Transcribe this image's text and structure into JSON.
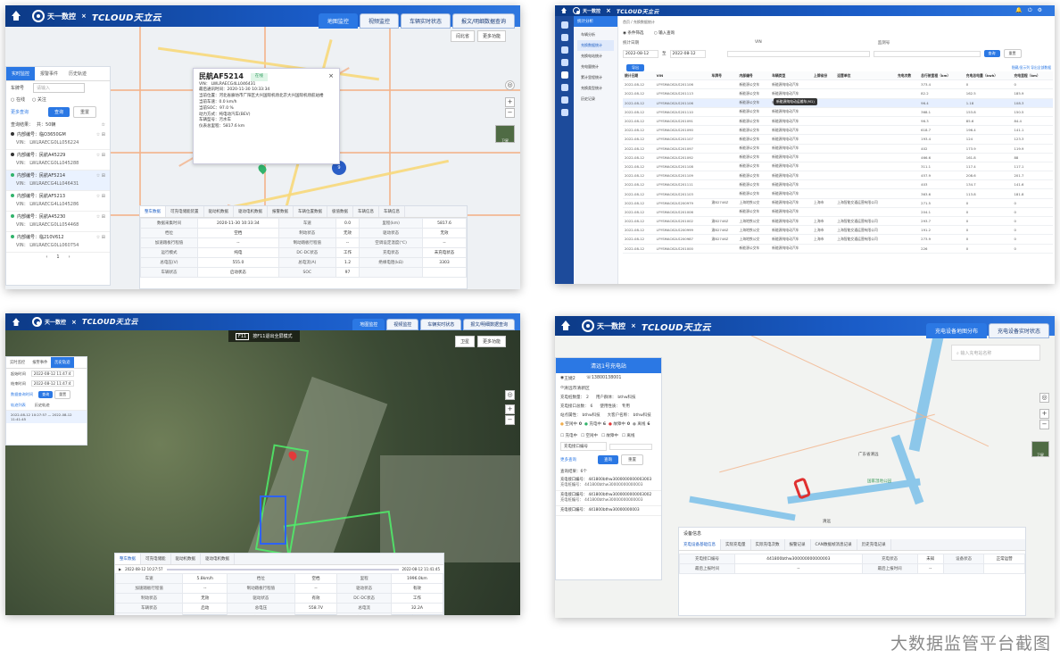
{
  "brand": {
    "logo1": "天一数控",
    "logo2": "TCLOUD天立云",
    "separator": "×"
  },
  "p1": {
    "tabs": [
      "地图监控",
      "视频监控",
      "车辆实时状态",
      "报文/明细数据查询"
    ],
    "active_tab": 0,
    "map_controls": [
      "闫北省",
      "更多功能"
    ],
    "side_tabs": [
      "实时监控",
      "报警事件",
      "历史轨迹"
    ],
    "plate_label": "车牌号",
    "plate_placeholder": "请输入",
    "opts": [
      "在线",
      "关注"
    ],
    "more_query": "更多查询",
    "btn_query": "查询",
    "btn_reset": "重置",
    "result_label": "查询结果：",
    "result_count": "共：50辆",
    "vehicles": [
      {
        "id": "内部编号：临O3650GM",
        "vin": "VIN： LWLRAECG0LL056224",
        "green": false,
        "sel": false
      },
      {
        "id": "内部编号：民航A45229",
        "vin": "VIN： LWLRAECG0LL045288",
        "green": false,
        "sel": false
      },
      {
        "id": "内部编号：民航AF5214",
        "vin": "VIN： LWLRAECG4LL046431",
        "green": true,
        "sel": true
      },
      {
        "id": "内部编号：民航AF5213",
        "vin": "VIN： LWLRAECG4LL045286",
        "green": true,
        "sel": false
      },
      {
        "id": "内部编号：民航A45230",
        "vin": "VIN： LWLRAECG0LL054468",
        "green": true,
        "sel": false
      },
      {
        "id": "内部编号：临210V612",
        "vin": "VIN： LWLRAECG0LL060754",
        "green": true,
        "sel": false
      }
    ],
    "page": "1",
    "popup": {
      "title": "民航AF5214",
      "status": "在线",
      "lines": [
        "VIN： LWLRAECG4LL046431",
        "最后通讯时间：2020-11-30 10:33:34",
        "当前位置：河北省廊坊市广阳区大兴国际机场北京大兴国际机场航站楼",
        "当前车速：0.0 km/h",
        "当前SOC：97.0 %",
        "动力方式：纯电动汽车(BEV)",
        "车辆型号：污水车",
        "仪表总里程：5817.6 km"
      ]
    },
    "cluster_count": "9",
    "detail_tabs": [
      "整车数据",
      "可充电储能装置",
      "驱动机数据",
      "驱动电机数据",
      "报警数据",
      "车辆位置数据",
      "极值数据",
      "车辆信息",
      "车辆信息"
    ],
    "detail_rows": [
      [
        "数据采集时间",
        "2020-11-30 10:33:34",
        "车速",
        "0.0",
        "里程(km)",
        "5817.6"
      ],
      [
        "档位",
        "空档",
        "制动状态",
        "无效",
        "驱动状态",
        "无效"
      ],
      [
        "加速踏板行程值",
        "--",
        "制动踏板行程值",
        "--",
        "空调设定温度(℃)",
        "--"
      ],
      [
        "运行模式",
        "纯电",
        "DC-DC状态",
        "工作",
        "充电状态",
        "未充电状态"
      ],
      [
        "总电压(V)",
        "555.0",
        "总电流(A)",
        "1.2",
        "绝缘电阻(kΩ)",
        "3303"
      ],
      [
        "车辆状态",
        "启动状态",
        "SOC",
        "97",
        "",
        ""
      ]
    ],
    "zoom_label": "卫星"
  },
  "p2": {
    "title": "统计分析",
    "breadcrumb": "首页 / 充换数据统计",
    "nav": [
      "车辆分析",
      "充换数据统计",
      "充换电站统计",
      "充电量统计",
      "累计里程统计",
      "充换类型统计",
      "历史记录"
    ],
    "filter_tabs": [
      "条件筛选",
      "输入查询"
    ],
    "filter_labels": [
      "统计日期",
      "VIN",
      "监测号"
    ],
    "filter_date": "2022-08-12",
    "filter_sep": "至",
    "btn_query": "查询",
    "btn_reset": "重置",
    "btn_export": "导出",
    "right_links": [
      "隐藏/显示列",
      "导出全部数据"
    ],
    "tooltip": "新能源纯电动运输车(M1)",
    "columns": [
      "统计日期",
      "VIN",
      "车牌号",
      "内部编号",
      "车辆类型",
      "上牌省份",
      "运营单位",
      "充电次数",
      "总行驶里程（km）",
      "充电总电量（kwh）",
      "充电里程（km）"
    ],
    "rows": [
      [
        "2022-08-12",
        "LFYSMAC62LS201106",
        "",
        "新能源公交车",
        "新能源纯电动汽车",
        "",
        "",
        "",
        "373.4",
        "0",
        "0"
      ],
      [
        "2022-08-12",
        "LFYSMAC62LS201113",
        "",
        "新能源公交车",
        "新能源纯电动汽车",
        "",
        "",
        "",
        "82.2",
        "162.5",
        "185.9"
      ],
      [
        "2022-08-12",
        "LFYSMAC62LS201106",
        "",
        "新能源公交车",
        "新能源纯电动汽车",
        "",
        "",
        "",
        "96.4",
        "1.18",
        "108.3"
      ],
      [
        "2022-08-12",
        "LFYSMAC62LS201110",
        "",
        "新能源公交车",
        "新能源纯电动汽车",
        "",
        "",
        "",
        "368.1",
        "153.8",
        "150.5"
      ],
      [
        "2022-08-12",
        "LFYSMAC62LS201091",
        "",
        "新能源公交车",
        "新能源纯电动汽车",
        "",
        "",
        "",
        "96.3",
        "85.6",
        "84.4"
      ],
      [
        "2022-08-12",
        "LFYSMAC62LS201090",
        "",
        "新能源公交车",
        "新能源纯电动汽车",
        "",
        "",
        "",
        "618.7",
        "196.4",
        "141.1"
      ],
      [
        "2022-08-12",
        "LFYSMAC62LS201107",
        "",
        "新能源公交车",
        "新能源纯电动汽车",
        "",
        "",
        "",
        "193.4",
        "124",
        "123.3"
      ],
      [
        "2022-08-12",
        "LFYSMAC62LS201097",
        "",
        "新能源公交车",
        "新能源纯电动汽车",
        "",
        "",
        "",
        "402",
        "173.9",
        "119.9"
      ],
      [
        "2022-08-12",
        "LFYSMAC62LS201092",
        "",
        "新能源公交车",
        "新能源纯电动汽车",
        "",
        "",
        "",
        "466.6",
        "161.8",
        "88"
      ],
      [
        "2022-08-12",
        "LFYSMAC62LS201108",
        "",
        "新能源公交车",
        "新能源纯电动汽车",
        "",
        "",
        "",
        "311.1",
        "117.4",
        "117.1"
      ],
      [
        "2022-08-12",
        "LFYSMAC62LS201109",
        "",
        "新能源公交车",
        "新能源纯电动汽车",
        "",
        "",
        "",
        "457.9",
        "208.6",
        "201.7"
      ],
      [
        "2022-08-12",
        "LFYSMAC62LS201111",
        "",
        "新能源公交车",
        "新能源纯电动汽车",
        "",
        "",
        "",
        "403",
        "134.7",
        "141.6"
      ],
      [
        "2022-08-12",
        "LFYSMAC62LS201103",
        "",
        "新能源公交车",
        "新能源纯电动汽车",
        "",
        "",
        "",
        "363.6",
        "113.8",
        "181.8"
      ],
      [
        "2022-08-12",
        "LFYSMAC62LS200979",
        "渝B2746Z",
        "上海地铁公交",
        "新能源纯电动汽车",
        "上海市",
        "上海智能交通运营有限公司",
        "",
        "271.5",
        "0",
        "0"
      ],
      [
        "2022-08-12",
        "LFYSMAC62LS201006",
        "",
        "新能源公交车",
        "新能源纯电动汽车",
        "",
        "",
        "",
        "204.1",
        "0",
        "0"
      ],
      [
        "2022-08-12",
        "LFYSMAC62LS201002",
        "渝B2746Z",
        "上海地铁公交",
        "新能源纯电动汽车",
        "上海市",
        "上海智能交通运营有限公司",
        "",
        "293.7",
        "0",
        "0"
      ],
      [
        "2022-08-12",
        "LFYSMAC62LS200999",
        "渝B2746Z",
        "上海地铁公交",
        "新能源纯电动汽车",
        "上海市",
        "上海智能交通运营有限公司",
        "",
        "191.2",
        "0",
        "0"
      ],
      [
        "2022-08-12",
        "LFYSMAC62LS200987",
        "渝B2746Z",
        "上海地铁公交",
        "新能源纯电动汽车",
        "上海市",
        "上海智能交通运营有限公司",
        "",
        "273.9",
        "0",
        "0"
      ],
      [
        "2022-08-12",
        "LFYSMAC62LS201000",
        "",
        "新能源公交车",
        "新能源纯电动汽车",
        "",
        "",
        "",
        "226",
        "0",
        "0"
      ]
    ]
  },
  "p3": {
    "tabs": [
      "地图监控",
      "视频监控",
      "车辆实时状态",
      "报文/明细数据查询"
    ],
    "active_tab": 0,
    "notice_key": "F11",
    "notice": "按F11退出全屏模式",
    "map_controls": [
      "卫星",
      "更多功能"
    ],
    "side_tabs": [
      "实时监控",
      "报警事件",
      "历史轨迹"
    ],
    "fields": [
      [
        "起始时间",
        "2022-08-12 11:47:4"
      ],
      [
        "结束时间",
        "2022-08-12 11:47:4"
      ]
    ],
    "hint": "数据查询时间",
    "btn_query": "查询",
    "btn_reset": "重置",
    "traj_tabs": [
      "轨迹列表",
      "历史轨迹"
    ],
    "traj_row": "2022-08-12 10:27:57 — 2022-08-12 11:41:45",
    "detail_tabs": [
      "整车数据",
      "可充电储能",
      "驱动机数据",
      "驱动电机数据"
    ],
    "play_start": "2022-08-12 10:27:57",
    "play_end": "2022-08-12 11:41:45",
    "detail_rows": [
      [
        "车速",
        "5.8km/h",
        "档位",
        "空档",
        "里程",
        "1996.0km"
      ],
      [
        "加速踏板行程值",
        "--",
        "制动踏板行程值",
        "--",
        "驱动状态",
        "有效"
      ],
      [
        "制动状态",
        "无效",
        "驱动状态",
        "有效",
        "DC-DC状态",
        "工作"
      ],
      [
        "车辆状态",
        "启动",
        "总电压",
        "558.7V",
        "总电流",
        "32.2A"
      ],
      [
        "SOC",
        "98%",
        "绝缘电阻",
        "1513kΩ",
        "充电状态",
        "未充电状态"
      ]
    ]
  },
  "p4": {
    "tabs": [
      "充电设备地图分布",
      "充电设备实时状态"
    ],
    "active_tab": 0,
    "search_placeholder": "输入充电站名称",
    "station": {
      "title": "清远1号充电站",
      "contact_name": "王婕2",
      "contact_phone": "13800138001",
      "address": "清远市清新区",
      "kv": [
        [
          "充电桩数量：",
          "2",
          "用户群体：",
          "bthw科技"
        ],
        [
          "充电接口总数：",
          "6",
          "使用性质：",
          "专用"
        ],
        [
          "站点属性：",
          "bthw科技",
          "大客户名称：",
          "bthw科技"
        ]
      ],
      "status": [
        [
          "空闲中",
          "0"
        ],
        [
          "充电中",
          "6"
        ],
        [
          "故障中",
          "0"
        ],
        [
          "离线",
          "6"
        ]
      ]
    },
    "filter_checks": [
      "充电中",
      "空闲中",
      "故障中",
      "离线"
    ],
    "filter_select": "充电接口编号",
    "more_query": "更多查询",
    "btn_query": "查询",
    "btn_reset": "重置",
    "result_label": "查询结果：",
    "result_count": "6个",
    "items": [
      {
        "a": "充电接口编号： 441800bthw3000000000003003",
        "b": "充电桩编号： 441800bthw30000000000003"
      },
      {
        "a": "充电接口编号： 441800bthw3000000000003002",
        "b": "充电桩编号： 441800bthw30000000000003"
      },
      {
        "a": "充电接口编号： 441800bthw30000000003",
        "b": ""
      }
    ],
    "info_title": "设备信息",
    "info_tabs": [
      "充电设备基础信息",
      "实际充电量",
      "实际充电次数",
      "报警记录",
      "CAN数据帧消息记录",
      "历史充电记录"
    ],
    "info_rows": [
      [
        "充电接口编号",
        "441800bthw300000000000003",
        "充电状态",
        "未知",
        "设备状态",
        "正常运营"
      ],
      [
        "最后上报时间",
        "--",
        "最后上报时间",
        "--",
        "",
        ""
      ]
    ],
    "map_labels": [
      "清远",
      "广东省清远",
      "国家湿地公园"
    ],
    "sat_label": "卫星"
  },
  "caption": "大数据监管平台截图"
}
